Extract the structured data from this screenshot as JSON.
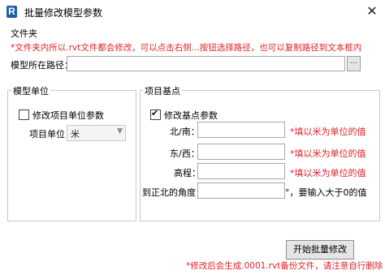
{
  "window": {
    "app_icon_letter": "R",
    "title": "批量修改模型参数",
    "close_glyph": "✕"
  },
  "folder_section": {
    "heading": "文件夹",
    "hint": "*文件夹内所以.rvt文件都会修改，可以点击右侧...按钮选择路径，也可以复制路径到文本框内",
    "path_label": "模型所在路径：",
    "path_value": "",
    "browse_label": "..."
  },
  "model_units": {
    "group_title": "模型单位",
    "modify_checkbox_label": "修改项目单位参数",
    "modify_checked": false,
    "project_unit_label": "项目单位：",
    "project_unit_value": "米"
  },
  "base_point": {
    "group_title": "项目基点",
    "modify_checkbox_label": "修改基点参数",
    "modify_checked": true,
    "fields": [
      {
        "label": "北/南：",
        "value": "",
        "hint": "*填以米为单位的值"
      },
      {
        "label": "东/西：",
        "value": "",
        "hint": "*填以米为单位的值"
      },
      {
        "label": "高程：",
        "value": "",
        "hint": "*填以米为单位的值"
      },
      {
        "label": "到正北的角度：",
        "value": "",
        "hint": "°，要输入大于0的值"
      }
    ]
  },
  "actions": {
    "start_button": "开始批量修改"
  },
  "footer": {
    "note": "*修改后会生成.0001.rvt备份文件，请注意自行删除"
  },
  "colors": {
    "hint_red": "#e0242b",
    "icon_blue": "#1f5fa8"
  }
}
